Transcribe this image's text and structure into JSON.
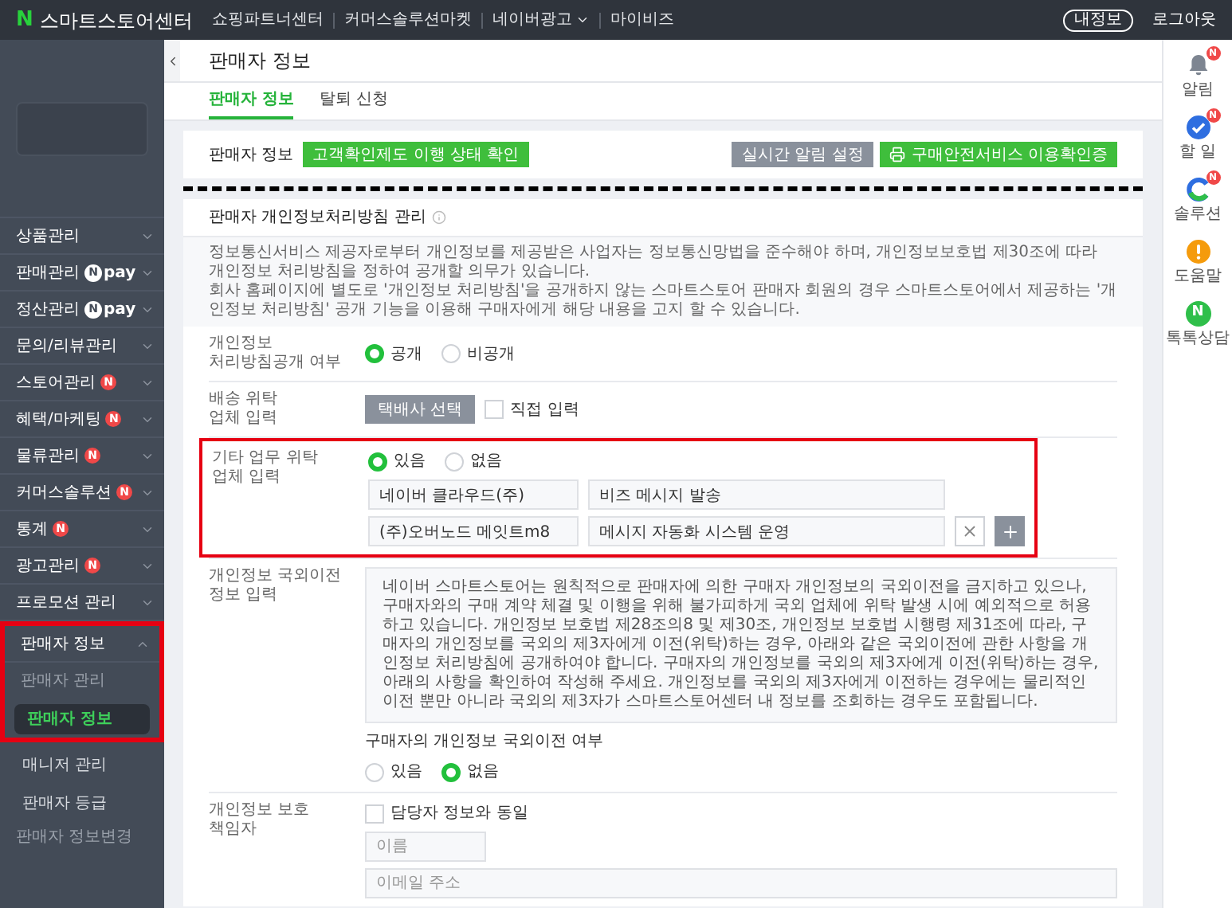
{
  "top_bar": {
    "logo_letter": "N",
    "brand": "스마트스토어센터",
    "nav": [
      {
        "label": "쇼핑파트너센터",
        "dropdown": false
      },
      {
        "label": "커머스솔루션마켓",
        "dropdown": false
      },
      {
        "label": "네이버광고",
        "dropdown": true
      },
      {
        "label": "마이비즈",
        "dropdown": false
      }
    ],
    "my_info": "내정보",
    "logout": "로그아웃"
  },
  "sidebar": {
    "items": [
      {
        "label": "상품관리",
        "expanded": false
      },
      {
        "label": "판매관리",
        "expanded": false,
        "badge": {
          "kind": "pay",
          "letter": "N",
          "text": "pay"
        }
      },
      {
        "label": "정산관리",
        "expanded": false,
        "badge": {
          "kind": "pay",
          "letter": "N",
          "text": "pay"
        }
      },
      {
        "label": "문의/리뷰관리",
        "expanded": false
      },
      {
        "label": "스토어관리",
        "expanded": false,
        "badge": {
          "kind": "new",
          "text": "N"
        }
      },
      {
        "label": "혜택/마케팅",
        "expanded": false,
        "badge": {
          "kind": "new",
          "text": "N"
        }
      },
      {
        "label": "물류관리",
        "expanded": false,
        "badge": {
          "kind": "new",
          "text": "N"
        }
      },
      {
        "label": "커머스솔루션",
        "expanded": false,
        "badge": {
          "kind": "new",
          "text": "N"
        }
      },
      {
        "label": "통계",
        "expanded": false,
        "badge": {
          "kind": "new",
          "text": "N"
        }
      },
      {
        "label": "광고관리",
        "expanded": false,
        "badge": {
          "kind": "new",
          "text": "N"
        }
      },
      {
        "label": "프로모션 관리",
        "expanded": false
      },
      {
        "label": "판매자 정보",
        "expanded": true,
        "highlighted": true,
        "groups": [
          {
            "label": "판매자 관리",
            "items": [
              {
                "label": "판매자 정보",
                "selected": true,
                "highlighted": true
              },
              {
                "label": "매니저 관리",
                "selected": false,
                "highlighted": false
              },
              {
                "label": "판매자 등급",
                "selected": false,
                "highlighted": false
              }
            ]
          },
          {
            "label": "판매자 정보변경"
          }
        ]
      }
    ]
  },
  "main": {
    "page_title": "판매자 정보",
    "tabs": [
      {
        "label": "판매자 정보",
        "selected": true
      },
      {
        "label": "탈퇴 신청",
        "selected": false
      }
    ],
    "seller_card": {
      "label": "판매자 정보",
      "status_button": "고객확인제도 이행 상태 확인",
      "buttons": [
        {
          "label": "실시간 알림 설정",
          "kind": "gray"
        },
        {
          "label": "구매안전서비스 이용확인증",
          "kind": "green"
        }
      ]
    },
    "privacy_section": {
      "title": "판매자 개인정보처리방침 관리",
      "notice": [
        "정보통신서비스 제공자로부터 개인정보를 제공받은 사업자는 정보통신망법을 준수해야 하며, 개인정보보호법 제30조에 따라 개인정보 처리방침을 정하여 공개할 의무가 있습니다.",
        "회사 홈페이지에 별도로 '개인정보 처리방침'을 공개하지 않는 스마트스토어 판매자 회원의 경우 스마트스토어에서 제공하는 '개인정보 처리방침' 공개 기능을 이용해 구매자에게 해당 내용을 고지 할 수 있습니다."
      ],
      "rows": [
        {
          "kind": "radio",
          "label_lines": [
            "개인정보",
            "처리방침공개 여부"
          ],
          "options": [
            {
              "label": "공개",
              "selected": true
            },
            {
              "label": "비공개",
              "selected": false
            }
          ]
        },
        {
          "kind": "courier",
          "label_lines": [
            "배송 위탁",
            "업체 입력"
          ],
          "button": "택배사 선택",
          "checkbox": {
            "label": "직접 입력",
            "checked": false
          }
        },
        {
          "kind": "entrusted",
          "highlighted": true,
          "label_lines": [
            "기타 업무 위탁",
            "업체 입력"
          ],
          "options": [
            {
              "label": "있음",
              "selected": true
            },
            {
              "label": "없음",
              "selected": false
            }
          ],
          "entries": [
            {
              "company": "네이버 클라우드(주)",
              "task": "비즈 메시지 발송",
              "actions": false
            },
            {
              "company": "(주)오버노드 메잇트m8",
              "task": "메시지 자동화 시스템 운영",
              "actions": true
            }
          ]
        },
        {
          "kind": "overseas",
          "label_lines": [
            "개인정보 국외이전",
            "정보 입력"
          ],
          "notice": "네이버 스마트스토어는 원칙적으로 판매자에 의한 구매자 개인정보의 국외이전을 금지하고 있으나, 구매자와의 구매 계약 체결 및 이행을 위해 불가피하게 국외 업체에 위탁 발생 시에 예외적으로 허용하고 있습니다. 개인정보 보호법 제28조의8 및 제30조, 개인정보 보호법 시행령 제31조에 따라, 구매자의 개인정보를 국외의 제3자에게 이전(위탁)하는 경우, 아래와 같은 국외이전에 관한 사항을 개인정보 처리방침에 공개하여야 합니다. 구매자의 개인정보를 국외의 제3자에게 이전(위탁)하는 경우, 아래의 사항을 확인하여 작성해 주세요. 개인정보를 국외의 제3자에게 이전하는 경우에는 물리적인 이전 뿐만 아니라 국외의 제3자가 스마트스토어센터 내 정보를 조회하는 경우도 포함됩니다.",
          "question": "구매자의 개인정보 국외이전 여부",
          "options": [
            {
              "label": "있음",
              "selected": false
            },
            {
              "label": "없음",
              "selected": true
            }
          ]
        },
        {
          "kind": "officer",
          "label_lines": [
            "개인정보 보호",
            "책임자"
          ],
          "checkbox": {
            "label": "담당자 정보와 동일",
            "checked": false
          },
          "fields": [
            {
              "placeholder": "이름"
            },
            {
              "placeholder": "이메일 주소"
            }
          ]
        }
      ]
    }
  },
  "right_rail": [
    {
      "kind": "bell",
      "label": "알림",
      "badge": "N"
    },
    {
      "kind": "check",
      "label": "할 일",
      "badge": "N"
    },
    {
      "kind": "solution",
      "label": "솔루션",
      "badge": "N"
    },
    {
      "kind": "help",
      "label": "도움말"
    },
    {
      "kind": "chat",
      "label": "톡톡상담",
      "letter": "N"
    }
  ]
}
